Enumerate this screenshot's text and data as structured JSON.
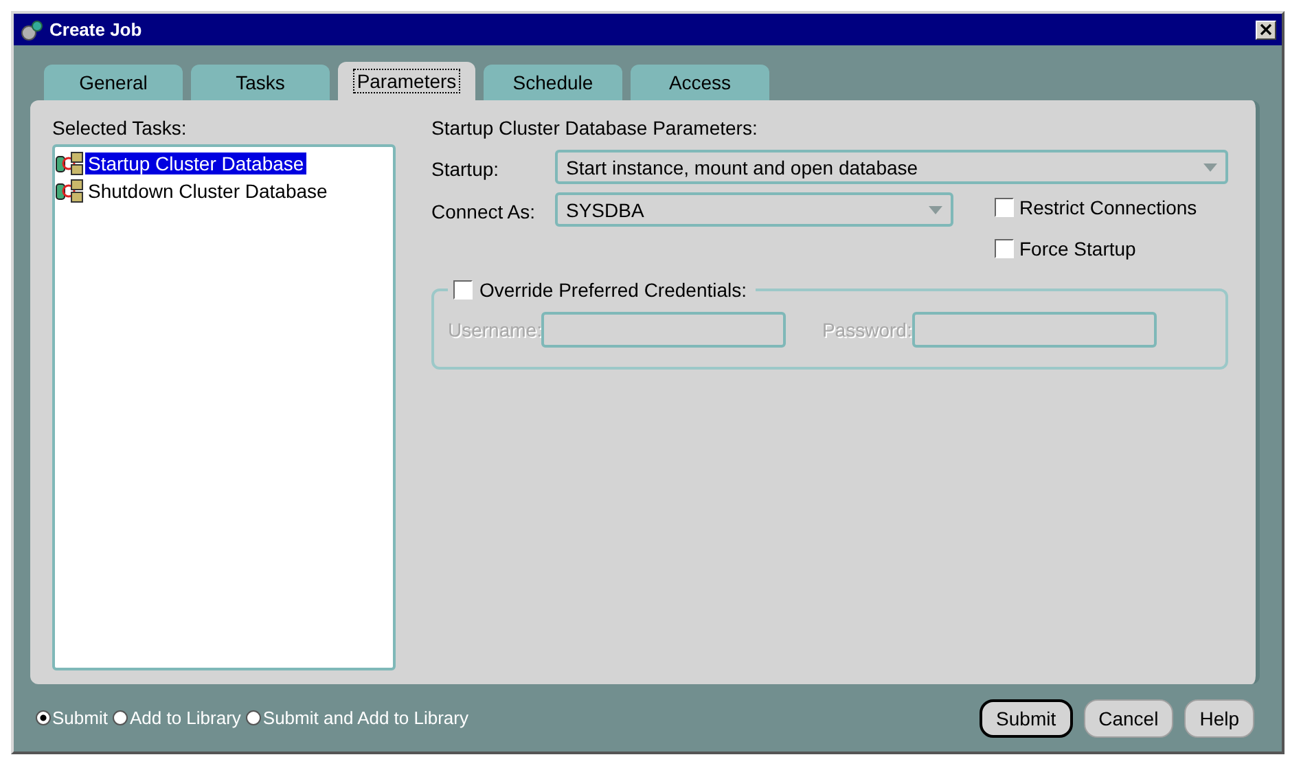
{
  "window": {
    "title": "Create Job"
  },
  "tabs": [
    {
      "label": "General",
      "selected": false
    },
    {
      "label": "Tasks",
      "selected": false
    },
    {
      "label": "Parameters",
      "selected": true
    },
    {
      "label": "Schedule",
      "selected": false
    },
    {
      "label": "Access",
      "selected": false
    }
  ],
  "selected_tasks": {
    "label": "Selected Tasks:",
    "items": [
      {
        "label": "Startup Cluster Database",
        "selected": true
      },
      {
        "label": "Shutdown Cluster Database",
        "selected": false
      }
    ]
  },
  "parameters": {
    "heading": "Startup Cluster Database Parameters:",
    "startup": {
      "label": "Startup:",
      "value": "Start instance, mount and open database"
    },
    "connect_as": {
      "label": "Connect As:",
      "value": "SYSDBA"
    },
    "options": [
      {
        "label": "Restrict Connections",
        "checked": false
      },
      {
        "label": "Force Startup",
        "checked": false
      }
    ],
    "credentials": {
      "label": "Override Preferred Credentials:",
      "checked": false,
      "disabled": true,
      "username_label": "Username:",
      "password_label": "Password:"
    }
  },
  "submit_options": [
    {
      "label": "Submit",
      "selected": true
    },
    {
      "label": "Add to Library",
      "selected": false
    },
    {
      "label": "Submit and Add to Library",
      "selected": false
    }
  ],
  "buttons": [
    "Submit",
    "Cancel",
    "Help"
  ]
}
